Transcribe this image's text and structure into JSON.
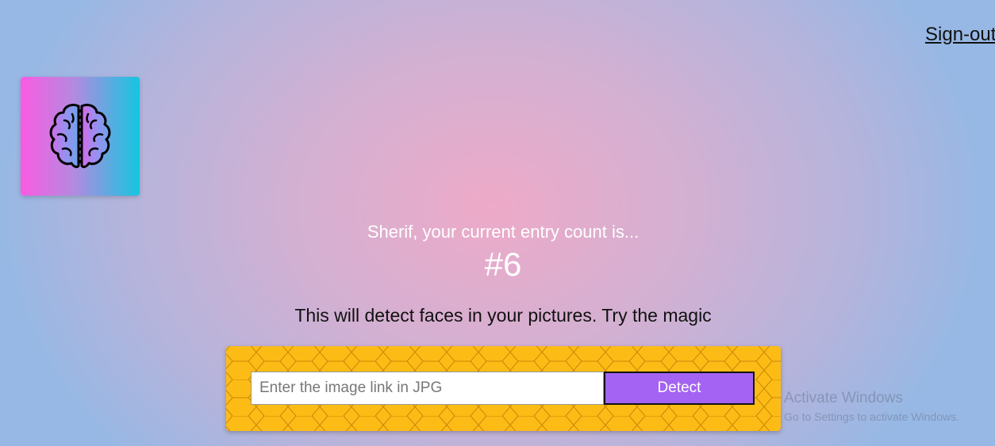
{
  "nav": {
    "signout_label": "Sign-out"
  },
  "logo": {
    "icon": "brain-icon",
    "gradient": [
      "#fa5be2",
      "#b38ae0",
      "#14c6e0"
    ]
  },
  "rank": {
    "message": "Sherif, your current entry count is...",
    "count": "#6"
  },
  "tagline": "This will detect faces in your pictures. Try the magic",
  "form": {
    "input_placeholder": "Enter the image link in JPG",
    "input_value": "",
    "button_label": "Detect",
    "panel_color": "#fdbc15",
    "button_color": "#a463f2"
  },
  "watermark": {
    "line1": "Activate Windows",
    "line2": "Go to Settings to activate Windows."
  }
}
